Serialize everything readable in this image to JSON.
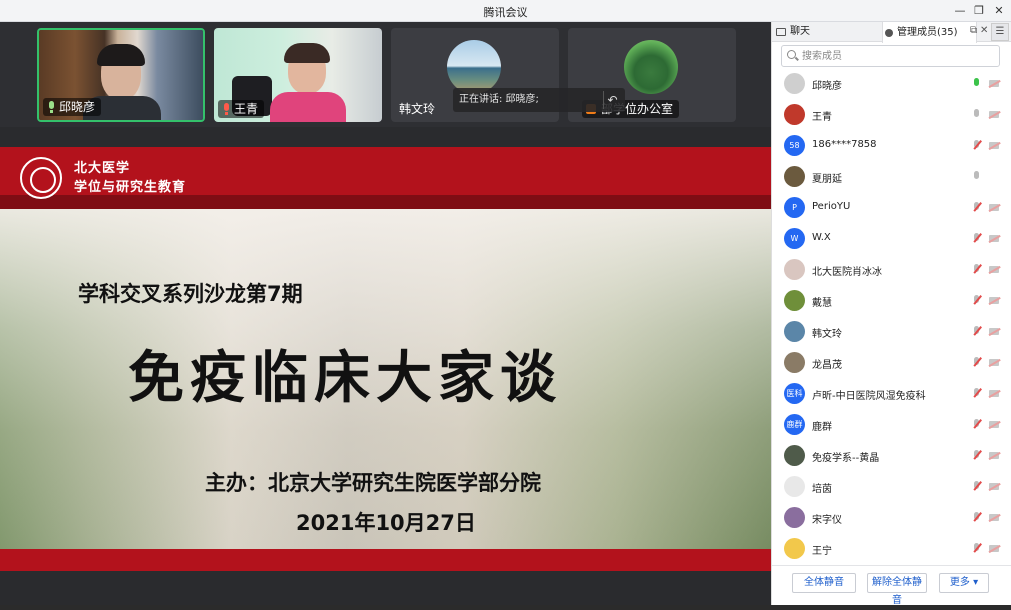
{
  "window": {
    "title": "腾讯会议",
    "min": "—",
    "restore": "❐",
    "close": "✕"
  },
  "video_tiles": [
    {
      "name": "邱晓彦",
      "mic": "on",
      "active": true
    },
    {
      "name": "王青",
      "mic": "muted"
    },
    {
      "name": "韩文玲"
    },
    {
      "name": "部学位办公室"
    }
  ],
  "speaking_tip": "正在讲话: 邱晓彦;",
  "slide": {
    "banner_line1": "北大医学",
    "banner_line2": "学位与研究生教育",
    "subtitle": "学科交叉系列沙龙第7期",
    "title": "免疫临床大家谈",
    "host": "主办：北京大学研究生院医学部分院",
    "date": "2021年10月27日"
  },
  "panel": {
    "tab_chat": "聊天",
    "tab_members": "管理成员(35)",
    "search_placeholder": "搜索成员",
    "btn_mute_all": "全体静音",
    "btn_unmute_all": "解除全体静音",
    "btn_more": "更多 ▾"
  },
  "members": [
    {
      "name": "邱晓彦",
      "avatar": "",
      "color": "#cfcfcf",
      "mic": "on",
      "cam": "off"
    },
    {
      "name": "王青",
      "avatar": "",
      "color": "#c0392b",
      "mic": "idle",
      "cam": "off"
    },
    {
      "name": "186****7858",
      "avatar": "58",
      "color": "#2468f2",
      "mic": "off",
      "cam": "off"
    },
    {
      "name": "夏朋延",
      "avatar": "",
      "color": "#6b5a3e",
      "mic": "idle",
      "cam": "none"
    },
    {
      "name": "PerioYU",
      "avatar": "P",
      "color": "#2468f2",
      "mic": "off",
      "cam": "off"
    },
    {
      "name": "W.X",
      "avatar": "W",
      "color": "#2468f2",
      "mic": "off",
      "cam": "off"
    },
    {
      "name": "北大医院肖冰冰",
      "avatar": "",
      "color": "#d9c6c0",
      "mic": "off",
      "cam": "off"
    },
    {
      "name": "戴慧",
      "avatar": "",
      "color": "#6f8f3a",
      "mic": "off",
      "cam": "off"
    },
    {
      "name": "韩文玲",
      "avatar": "",
      "color": "#5b86a8",
      "mic": "off",
      "cam": "off"
    },
    {
      "name": "龙昌茂",
      "avatar": "",
      "color": "#8a7b66",
      "mic": "off",
      "cam": "off"
    },
    {
      "name": "卢昕-中日医院风湿免疫科",
      "avatar": "医科",
      "color": "#2468f2",
      "mic": "off",
      "cam": "off"
    },
    {
      "name": "鹿群",
      "avatar": "鹿群",
      "color": "#2468f2",
      "mic": "off",
      "cam": "off"
    },
    {
      "name": "免疫学系--黄晶",
      "avatar": "",
      "color": "#4f5b4a",
      "mic": "off",
      "cam": "off"
    },
    {
      "name": "培茵",
      "avatar": "",
      "color": "#e8e8e8",
      "mic": "off",
      "cam": "off"
    },
    {
      "name": "宋字仪",
      "avatar": "",
      "color": "#8a6e9e",
      "mic": "off",
      "cam": "off"
    },
    {
      "name": "王宁",
      "avatar": "",
      "color": "#f2c84b",
      "mic": "off",
      "cam": "off"
    }
  ]
}
